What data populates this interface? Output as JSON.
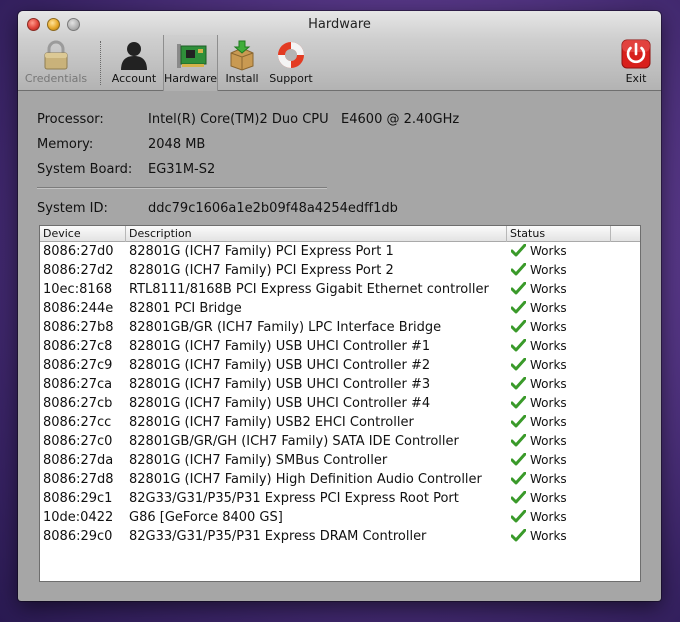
{
  "window": {
    "title": "Hardware"
  },
  "toolbar": {
    "credentials": "Credentials",
    "account": "Account",
    "hardware": "Hardware",
    "install": "Install",
    "support": "Support",
    "exit": "Exit"
  },
  "system": {
    "processor_label": "Processor:",
    "processor_value": "Intel(R) Core(TM)2 Duo CPU   E4600 @ 2.40GHz",
    "memory_label": "Memory:",
    "memory_value": "2048 MB",
    "board_label": "System Board:",
    "board_value": "EG31M-S2",
    "id_label": "System ID:",
    "id_value": "ddc79c1606a1e2b09f48a4254edff1db"
  },
  "table": {
    "columns": [
      "Device",
      "Description",
      "Status",
      ""
    ],
    "rows": [
      {
        "device": "8086:27d0",
        "description": "82801G (ICH7 Family) PCI Express Port 1",
        "status": "Works"
      },
      {
        "device": "8086:27d2",
        "description": "82801G (ICH7 Family) PCI Express Port 2",
        "status": "Works"
      },
      {
        "device": "10ec:8168",
        "description": "RTL8111/8168B PCI Express Gigabit Ethernet controller",
        "status": "Works"
      },
      {
        "device": "8086:244e",
        "description": "82801 PCI Bridge",
        "status": "Works"
      },
      {
        "device": "8086:27b8",
        "description": "82801GB/GR (ICH7 Family) LPC Interface Bridge",
        "status": "Works"
      },
      {
        "device": "8086:27c8",
        "description": "82801G (ICH7 Family) USB UHCI Controller #1",
        "status": "Works"
      },
      {
        "device": "8086:27c9",
        "description": "82801G (ICH7 Family) USB UHCI Controller #2",
        "status": "Works"
      },
      {
        "device": "8086:27ca",
        "description": "82801G (ICH7 Family) USB UHCI Controller #3",
        "status": "Works"
      },
      {
        "device": "8086:27cb",
        "description": "82801G (ICH7 Family) USB UHCI Controller #4",
        "status": "Works"
      },
      {
        "device": "8086:27cc",
        "description": "82801G (ICH7 Family) USB2 EHCI Controller",
        "status": "Works"
      },
      {
        "device": "8086:27c0",
        "description": "82801GB/GR/GH (ICH7 Family) SATA IDE Controller",
        "status": "Works"
      },
      {
        "device": "8086:27da",
        "description": "82801G (ICH7 Family) SMBus Controller",
        "status": "Works"
      },
      {
        "device": "8086:27d8",
        "description": "82801G (ICH7 Family) High Definition Audio Controller",
        "status": "Works"
      },
      {
        "device": "8086:29c1",
        "description": "82G33/G31/P35/P31 Express PCI Express Root Port",
        "status": "Works"
      },
      {
        "device": "10de:0422",
        "description": "G86 [GeForce 8400 GS]",
        "status": "Works"
      },
      {
        "device": "8086:29c0",
        "description": "82G33/G31/P35/P31 Express DRAM Controller",
        "status": "Works"
      }
    ]
  },
  "colors": {
    "works_check": "#3a9a2a",
    "exit_red": "#d8201c"
  }
}
